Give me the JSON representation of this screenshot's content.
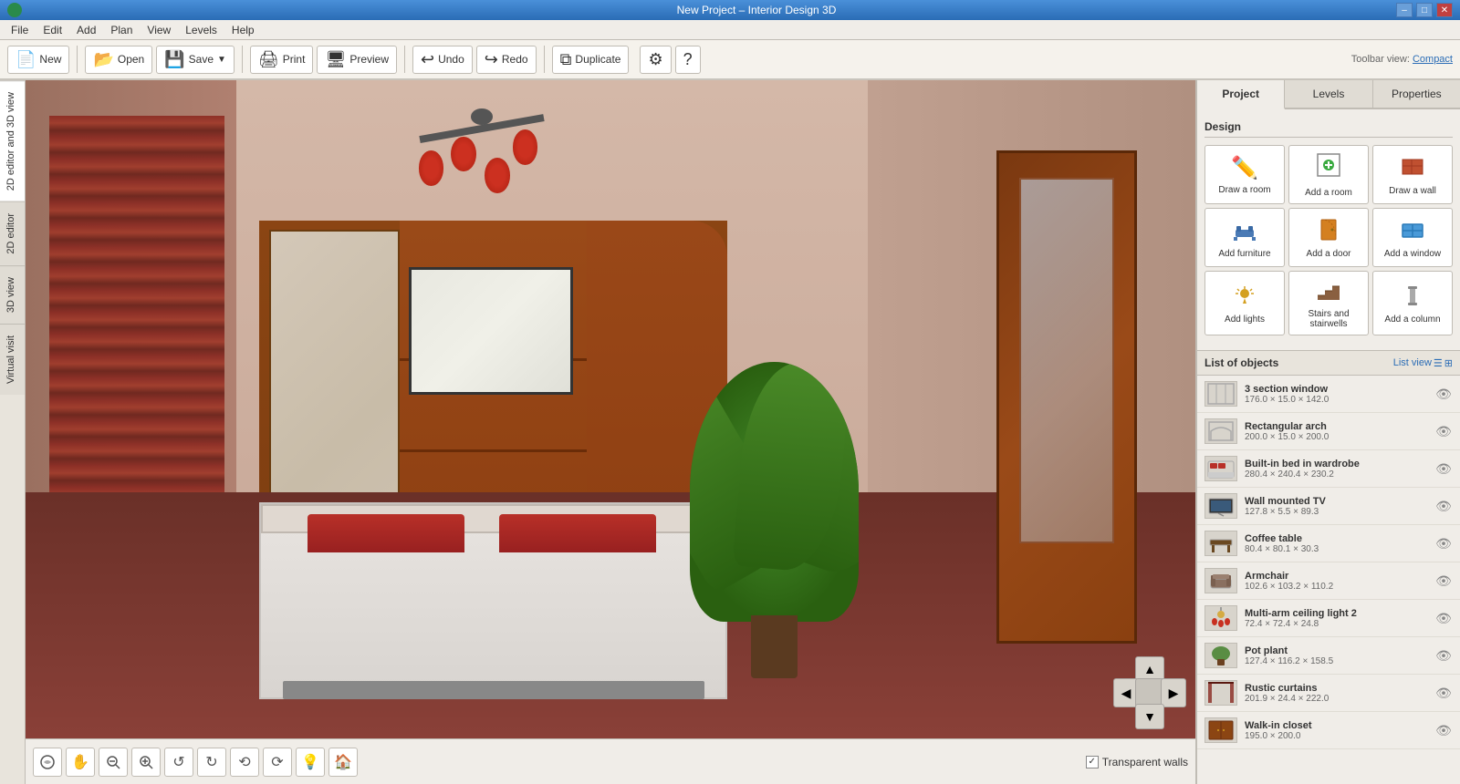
{
  "window": {
    "title": "New Project – Interior Design 3D",
    "controls": {
      "minimize": "–",
      "maximize": "□",
      "close": "✕"
    }
  },
  "menubar": {
    "items": [
      "File",
      "Edit",
      "Add",
      "Plan",
      "View",
      "Levels",
      "Help"
    ]
  },
  "toolbar": {
    "buttons": [
      {
        "id": "new",
        "icon": "📄",
        "label": "New"
      },
      {
        "id": "open",
        "icon": "📂",
        "label": "Open"
      },
      {
        "id": "save",
        "icon": "💾",
        "label": "Save",
        "has_arrow": true
      },
      {
        "id": "print",
        "icon": "🖨",
        "label": "Print"
      },
      {
        "id": "preview",
        "icon": "🖥",
        "label": "Preview"
      },
      {
        "id": "undo",
        "icon": "↩",
        "label": "Undo"
      },
      {
        "id": "redo",
        "icon": "↪",
        "label": "Redo"
      },
      {
        "id": "duplicate",
        "icon": "⧉",
        "label": "Duplicate"
      }
    ],
    "settings_icon": "⚙",
    "help_icon": "?",
    "view_label": "Toolbar view:",
    "view_mode": "Compact"
  },
  "side_tabs": [
    {
      "id": "2d-3d",
      "label": "2D editor and 3D view"
    },
    {
      "id": "2d",
      "label": "2D editor"
    },
    {
      "id": "3d",
      "label": "3D view"
    },
    {
      "id": "virtual",
      "label": "Virtual visit"
    }
  ],
  "viewport": {
    "bottom_tools": [
      {
        "id": "360",
        "icon": "⟲",
        "title": "360"
      },
      {
        "id": "hand",
        "icon": "✋",
        "title": "Pan"
      },
      {
        "id": "zoom-out",
        "icon": "🔍-",
        "title": "Zoom out"
      },
      {
        "id": "zoom-in",
        "icon": "🔍+",
        "title": "Zoom in"
      },
      {
        "id": "rotate-left",
        "icon": "↺",
        "title": "Rotate left"
      },
      {
        "id": "rotate-right",
        "icon": "↻",
        "title": "Rotate right"
      },
      {
        "id": "orbit-left",
        "icon": "⟲",
        "title": "Orbit left"
      },
      {
        "id": "orbit-right",
        "icon": "⟳",
        "title": "Orbit right"
      },
      {
        "id": "light",
        "icon": "💡",
        "title": "Light"
      },
      {
        "id": "home",
        "icon": "🏠",
        "title": "Home view"
      }
    ],
    "transparent_walls_label": "Transparent walls",
    "transparent_walls_checked": true
  },
  "right_panel": {
    "tabs": [
      "Project",
      "Levels",
      "Properties"
    ],
    "active_tab": "Project",
    "design_section_title": "Design",
    "design_buttons": [
      {
        "id": "draw-room",
        "icon": "✏",
        "label": "Draw a room",
        "color": "#e8a020"
      },
      {
        "id": "add-room",
        "icon": "➕",
        "label": "Add a room",
        "color": "#3aaa40"
      },
      {
        "id": "draw-wall",
        "icon": "🧱",
        "label": "Draw a wall",
        "color": "#c05030"
      },
      {
        "id": "add-furniture",
        "icon": "🪑",
        "label": "Add furniture",
        "color": "#4a7ab5"
      },
      {
        "id": "add-door",
        "icon": "🚪",
        "label": "Add a door",
        "color": "#d48020"
      },
      {
        "id": "add-window",
        "icon": "🪟",
        "label": "Add a window",
        "color": "#4a9ad8"
      },
      {
        "id": "add-lights",
        "icon": "💡",
        "label": "Add lights",
        "color": "#d4a020"
      },
      {
        "id": "stairs",
        "icon": "🪜",
        "label": "Stairs and stairwells",
        "color": "#8a6040"
      },
      {
        "id": "add-column",
        "icon": "🏛",
        "label": "Add a column",
        "color": "#888"
      }
    ],
    "objects_title": "List of objects",
    "list_view_label": "List view",
    "objects": [
      {
        "id": 1,
        "name": "3 section window",
        "dims": "176.0 × 15.0 × 142.0",
        "icon": "🪟",
        "visible": true
      },
      {
        "id": 2,
        "name": "Rectangular arch",
        "dims": "200.0 × 15.0 × 200.0",
        "icon": "⬜",
        "visible": true
      },
      {
        "id": 3,
        "name": "Built-in bed in wardrobe",
        "dims": "280.4 × 240.4 × 230.2",
        "icon": "🛏",
        "visible": true
      },
      {
        "id": 4,
        "name": "Wall mounted TV",
        "dims": "127.8 × 5.5 × 89.3",
        "icon": "📺",
        "visible": true
      },
      {
        "id": 5,
        "name": "Coffee table",
        "dims": "80.4 × 80.1 × 30.3",
        "icon": "🪑",
        "visible": true
      },
      {
        "id": 6,
        "name": "Armchair",
        "dims": "102.6 × 103.2 × 110.2",
        "icon": "🪑",
        "visible": true
      },
      {
        "id": 7,
        "name": "Multi-arm ceiling light 2",
        "dims": "72.4 × 72.4 × 24.8",
        "icon": "💡",
        "visible": true
      },
      {
        "id": 8,
        "name": "Pot plant",
        "dims": "127.4 × 116.2 × 158.5",
        "icon": "🪴",
        "visible": true
      },
      {
        "id": 9,
        "name": "Rustic curtains",
        "dims": "201.9 × 24.4 × 222.0",
        "icon": "🪟",
        "visible": true
      },
      {
        "id": 10,
        "name": "Walk-in closet",
        "dims": "195.0 × 200.0",
        "icon": "🚪",
        "visible": true
      }
    ]
  }
}
